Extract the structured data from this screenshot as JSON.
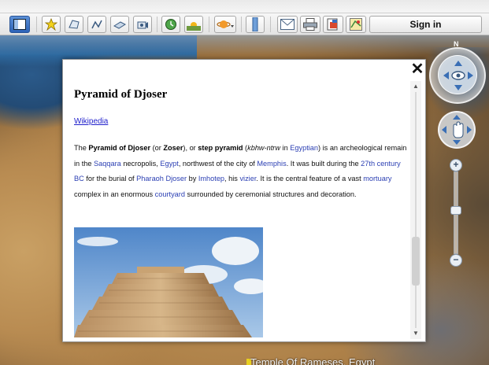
{
  "toolbar": {
    "buttons": [
      {
        "name": "sidebar-toggle",
        "icon": "sidebar-icon"
      },
      {
        "name": "add-placemark",
        "icon": "placemark-icon"
      },
      {
        "name": "add-polygon",
        "icon": "polygon-icon"
      },
      {
        "name": "add-path",
        "icon": "path-icon"
      },
      {
        "name": "add-image-overlay",
        "icon": "image-overlay-icon"
      },
      {
        "name": "record-tour",
        "icon": "record-tour-icon"
      },
      {
        "name": "historical-imagery",
        "icon": "clock-icon"
      },
      {
        "name": "sunlight",
        "icon": "sunlight-icon"
      },
      {
        "name": "switch-planet",
        "icon": "planet-icon"
      },
      {
        "name": "ruler",
        "icon": "ruler-icon"
      },
      {
        "name": "email",
        "icon": "email-icon"
      },
      {
        "name": "print",
        "icon": "print-icon"
      },
      {
        "name": "save-image",
        "icon": "save-image-icon"
      },
      {
        "name": "view-in-maps",
        "icon": "maps-icon"
      }
    ],
    "sign_in": "Sign in"
  },
  "balloon": {
    "title": "Pyramid of Djoser",
    "link": "Wikipedia",
    "close": "✕",
    "paragraph": [
      {
        "t": "The "
      },
      {
        "t": "Pyramid of Djoser",
        "b": true
      },
      {
        "t": " (or "
      },
      {
        "t": "Zoser",
        "b": true
      },
      {
        "t": "), or "
      },
      {
        "t": "step pyramid",
        "b": true
      },
      {
        "t": " ("
      },
      {
        "t": "kbhw-ntrw",
        "i": true
      },
      {
        "t": " in "
      },
      {
        "t": "Egyptian",
        "l": true
      },
      {
        "t": ") is an archeological remain in the "
      },
      {
        "t": "Saqqara",
        "l": true
      },
      {
        "t": " necropolis, "
      },
      {
        "t": "Egypt",
        "l": true
      },
      {
        "t": ", northwest of the city of "
      },
      {
        "t": "Memphis",
        "l": true
      },
      {
        "t": ". It was built during the "
      },
      {
        "t": "27th century BC",
        "l": true
      },
      {
        "t": " for the burial of "
      },
      {
        "t": "Pharaoh",
        "l": true
      },
      {
        "t": " "
      },
      {
        "t": "Djoser",
        "l": true
      },
      {
        "t": " by "
      },
      {
        "t": "Imhotep",
        "l": true
      },
      {
        "t": ", his "
      },
      {
        "t": "vizier",
        "l": true
      },
      {
        "t": ". It is the central feature of a vast "
      },
      {
        "t": "mortuary",
        "l": true
      },
      {
        "t": " complex in an enormous "
      },
      {
        "t": "courtyard",
        "l": true
      },
      {
        "t": " surrounded by ceremonial structures and decoration."
      }
    ],
    "scroll_position": 0.78
  },
  "navigation": {
    "north_label": "N",
    "zoom_in": "+",
    "zoom_out": "−",
    "zoom_level": 0.47
  },
  "map": {
    "place_label": "Temple Of Rameses, Egypt"
  },
  "colors": {
    "link": "#2b3fb3",
    "toolbar_active": "#2d63b8"
  }
}
